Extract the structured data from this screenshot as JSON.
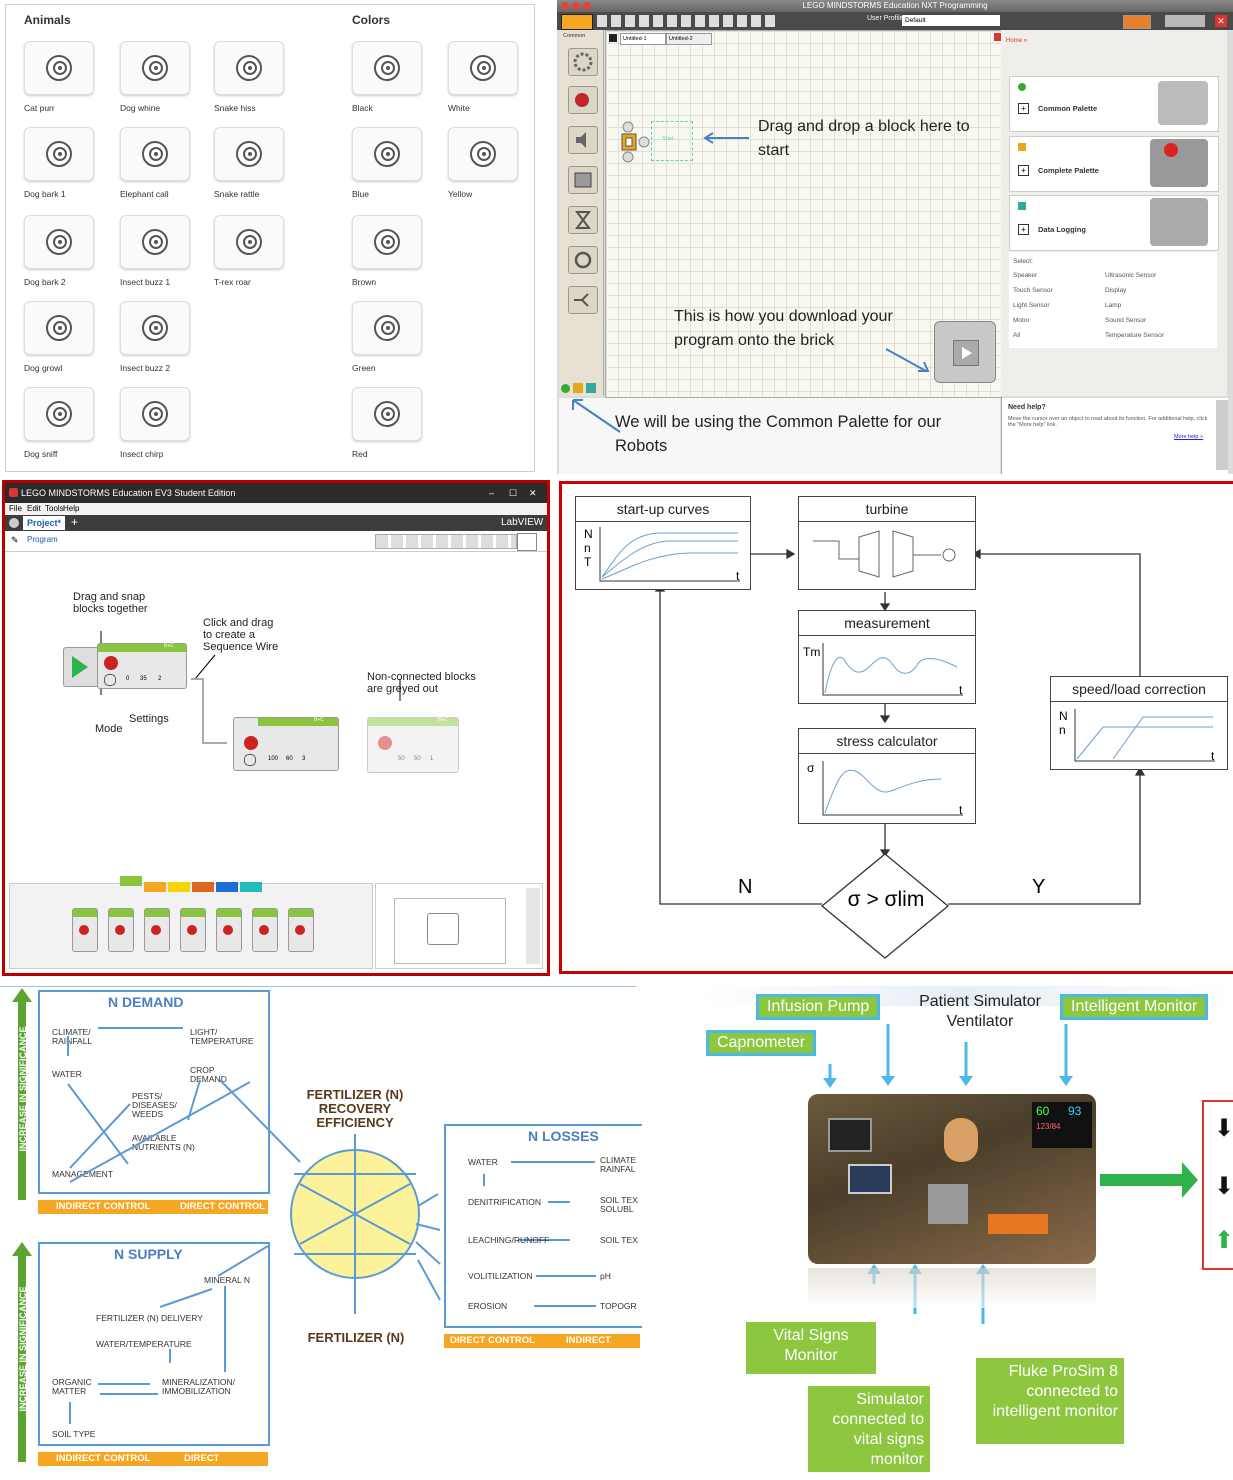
{
  "sounds": {
    "animals_title": "Animals",
    "colors_title": "Colors",
    "animals": [
      "Cat purr",
      "Dog whine",
      "Snake hiss",
      "Dog bark 1",
      "Elephant call",
      "Snake rattle",
      "Dog bark 2",
      "Insect buzz 1",
      "T-rex roar",
      "Dog growl",
      "Insect buzz 2",
      "Dog sniff",
      "Insect chirp"
    ],
    "colors": [
      "Black",
      "White",
      "Blue",
      "Yellow",
      "Brown",
      "Green",
      "Red"
    ]
  },
  "nxt": {
    "window_title": "LEGO MINDSTORMS Education NXT Programming",
    "user_profile_label": "User Profile:",
    "user_profile_value": "Default",
    "palette_tab": "Common",
    "tab1": "Untitled-1",
    "tab2": "Untitled-2",
    "start_label": "Start",
    "annotation_drag": "Drag and drop a block here to start",
    "annotation_download": "This is how you download your program onto the brick",
    "annotation_palette": "We will be using the Common Palette for our Robots",
    "home_link": "Home »",
    "common_palette": "Common Palette",
    "complete_palette": "Complete Palette",
    "data_logging": "Data Logging",
    "select_label": "Select:",
    "select_items": [
      "Speaker",
      "Ultrasonic Sensor",
      "Touch Sensor",
      "Display",
      "Light Sensor",
      "Lamp",
      "Motor",
      "Sound Sensor",
      "All",
      "Temperature Sensor"
    ],
    "help_title": "Need help?",
    "help_text": "Move the cursor over an object to read about its function. For additional help, click the \"More help\" link.",
    "more_help": "More help »"
  },
  "ev3": {
    "window_title": "LEGO MINDSTORMS Education EV3 Student Edition",
    "menu": [
      "File",
      "Edit",
      "Tools",
      "Help"
    ],
    "project_tab": "Project*",
    "program_tab": "Program",
    "labview": "LabVIEW",
    "ann_snap": "Drag and snap blocks together",
    "ann_wire": "Click and drag to create a Sequence Wire",
    "ann_grey": "Non-connected blocks are greyed out",
    "mode": "Mode",
    "settings": "Settings",
    "port": "B+C",
    "block1_vals": [
      "0",
      "35",
      "2"
    ],
    "block2_vals": [
      "100",
      "60",
      "3"
    ],
    "block3_vals": [
      "50",
      "50",
      "1"
    ]
  },
  "turbine": {
    "startup": "start-up curves",
    "startup_axis": "N\nn\nT",
    "turbine": "turbine",
    "measurement": "measurement",
    "meas_axis": "Tm",
    "stress": "stress calculator",
    "stress_axis": "σ",
    "speed": "speed/load correction",
    "speed_axis": "N\nn",
    "t": "t",
    "N": "N",
    "Y": "Y",
    "condition": "σ > σlim"
  },
  "fertilizer": {
    "n_demand": "N DEMAND",
    "n_supply": "N SUPPLY",
    "n_losses": "N LOSSES",
    "increase": "INCREASE IN SIGNIFICANCE",
    "indirect": "INDIRECT CONTROL",
    "direct": "DIRECT CONTROL",
    "center_title": "FERTILIZER (N) RECOVERY EFFICIENCY",
    "center_bottom": "FERTILIZER (N)",
    "demand": {
      "climate": "CLIMATE/ RAINFALL",
      "light": "LIGHT/ TEMPERATURE",
      "water": "WATER",
      "crop": "CROP DEMAND",
      "pests": "PESTS/ DISEASES/ WEEDS",
      "available": "AVAILABLE NUTRIENTS (N)",
      "management": "MANAGEMENT"
    },
    "supply": {
      "mineral": "MINERAL N",
      "delivery": "FERTILIZER (N) DELIVERY",
      "watertemp": "WATER/TEMPERATURE",
      "organic": "ORGANIC MATTER",
      "mineralization": "MINERALIZATION/ IMMOBILIZATION",
      "soil": "SOIL TYPE"
    },
    "losses": {
      "water": "WATER",
      "climate": "CLIMATE RAINFAL",
      "denit": "DENITRIFICATION",
      "soiltex": "SOIL TEX SOLUBL",
      "leaching": "LEACHING/RUNOFF",
      "soiltex2": "SOIL TEX",
      "volit": "VOLITILIZATION",
      "ph": "pH",
      "erosion": "EROSION",
      "topog": "TOPOGR",
      "direct": "DIRECT CONTROL",
      "indirect": "INDIRECT CONT"
    }
  },
  "simulator": {
    "infusion": "Infusion Pump",
    "patient": "Patient Simulator Ventilator",
    "intelligent": "Intelligent Monitor",
    "capnometer": "Capnometer",
    "vital": "Vital Signs Monitor",
    "sim_connected": "Simulator connected to vital signs monitor",
    "fluke": "Fluke ProSim 8 connected to intelligent monitor",
    "monitor_vals": [
      "60",
      "93",
      "123/84"
    ]
  },
  "colors": {
    "blue": "#5b9bd5",
    "orange": "#f5a623",
    "green": "#8dc63f",
    "red": "#c00000"
  }
}
